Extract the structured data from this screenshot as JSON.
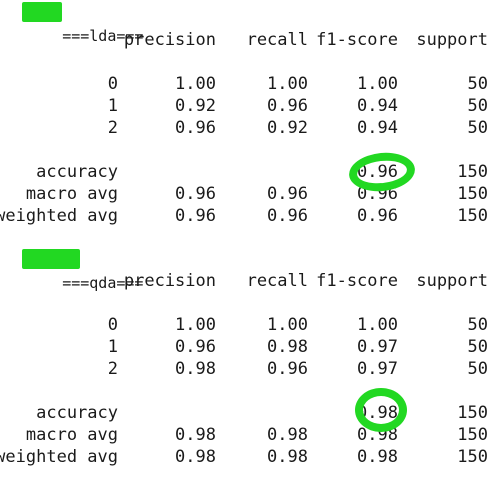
{
  "reports": [
    {
      "title": "===lda===",
      "headers": [
        "precision",
        "recall",
        "f1-score",
        "support"
      ],
      "class_rows": [
        {
          "label": "0",
          "precision": "1.00",
          "recall": "1.00",
          "f1": "1.00",
          "support": "50"
        },
        {
          "label": "1",
          "precision": "0.92",
          "recall": "0.96",
          "f1": "0.94",
          "support": "50"
        },
        {
          "label": "2",
          "precision": "0.96",
          "recall": "0.92",
          "f1": "0.94",
          "support": "50"
        }
      ],
      "accuracy": {
        "label": "accuracy",
        "f1": "0.96",
        "support": "150"
      },
      "macro": {
        "label": "macro avg",
        "precision": "0.96",
        "recall": "0.96",
        "f1": "0.96",
        "support": "150"
      },
      "weighted": {
        "label": "weighted avg",
        "precision": "0.96",
        "recall": "0.96",
        "f1": "0.96",
        "support": "150"
      }
    },
    {
      "title": "===qda===",
      "headers": [
        "precision",
        "recall",
        "f1-score",
        "support"
      ],
      "class_rows": [
        {
          "label": "0",
          "precision": "1.00",
          "recall": "1.00",
          "f1": "1.00",
          "support": "50"
        },
        {
          "label": "1",
          "precision": "0.96",
          "recall": "0.98",
          "f1": "0.97",
          "support": "50"
        },
        {
          "label": "2",
          "precision": "0.98",
          "recall": "0.96",
          "f1": "0.97",
          "support": "50"
        }
      ],
      "accuracy": {
        "label": "accuracy",
        "f1": "0.98",
        "support": "150"
      },
      "macro": {
        "label": "macro avg",
        "precision": "0.98",
        "recall": "0.98",
        "f1": "0.98",
        "support": "150"
      },
      "weighted": {
        "label": "weighted avg",
        "precision": "0.98",
        "recall": "0.98",
        "f1": "0.98",
        "support": "150"
      }
    }
  ],
  "highlight_color": "#22d822"
}
